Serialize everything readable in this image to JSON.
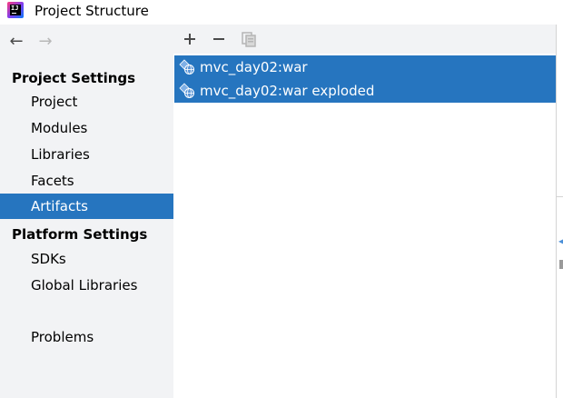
{
  "window": {
    "title": "Project Structure",
    "app_icon": "intellij-idea-icon"
  },
  "navigation": {
    "back_icon": "arrow-left-icon",
    "forward_icon": "arrow-right-icon"
  },
  "sidebar": {
    "sections": [
      {
        "header": "Project Settings",
        "items": [
          "Project",
          "Modules",
          "Libraries",
          "Facets",
          "Artifacts"
        ]
      },
      {
        "header": "Platform Settings",
        "items": [
          "SDKs",
          "Global Libraries"
        ]
      }
    ],
    "extra_items": [
      "Problems"
    ],
    "selected_item": "Artifacts"
  },
  "toolbar": {
    "add_icon": "plus-icon",
    "remove_icon": "minus-icon",
    "copy_icon": "copy-icon"
  },
  "artifacts": [
    {
      "name": "mvc_day02:war",
      "selected": true
    },
    {
      "name": "mvc_day02:war exploded",
      "selected": true
    }
  ],
  "colors": {
    "selection": "#2675bf",
    "sidebar_bg": "#f2f3f5"
  }
}
